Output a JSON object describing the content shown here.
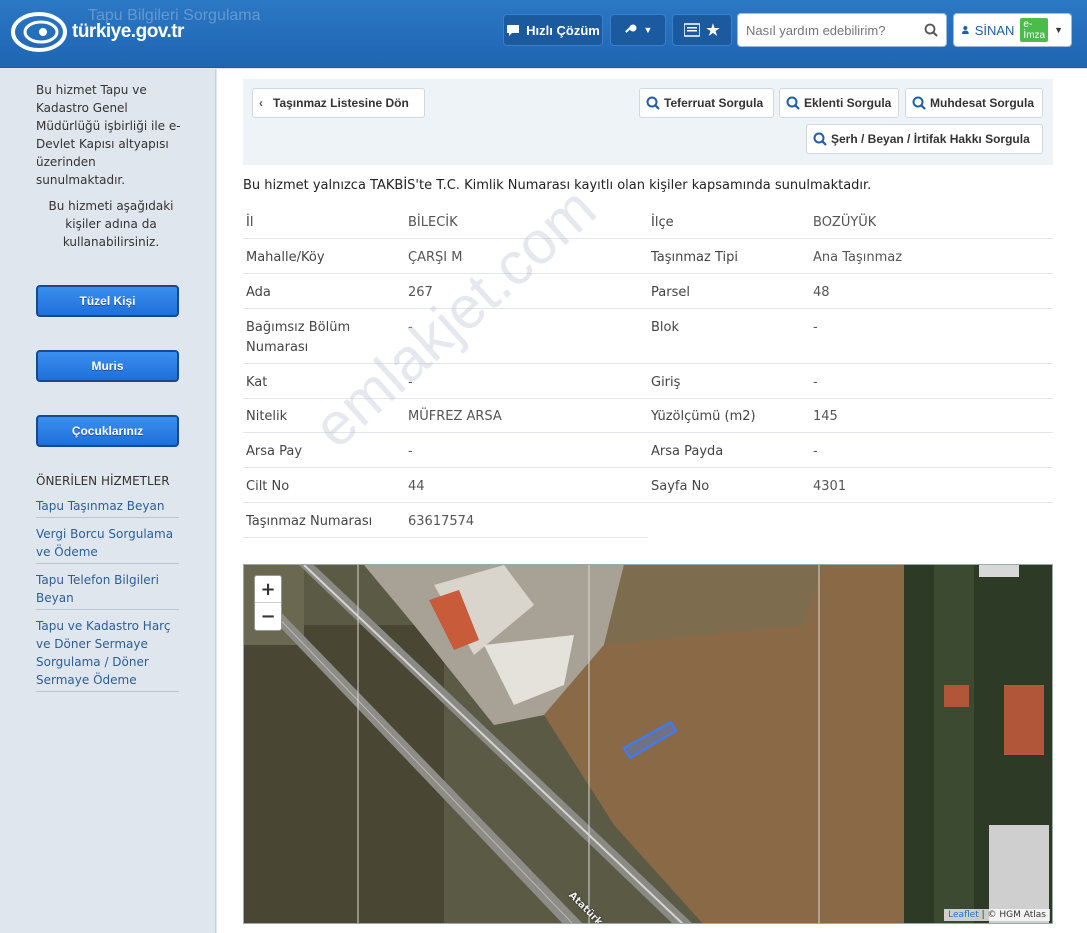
{
  "header": {
    "logo_text": "türkiye.gov.tr",
    "ghost_title": "Tapu Bilgileri Sorgulama",
    "quick_solution_label": "Hızlı Çözüm",
    "search_placeholder": "Nasıl yardım edebilirim?",
    "user_name": "SİNAN",
    "user_badge": "e-İmza",
    "colors": {
      "bar": "#1f65b2",
      "badge": "#4cbb4c"
    }
  },
  "sidebar": {
    "intro": "Bu hizmet Tapu ve Kadastro Genel Müdürlüğü işbirliği ile e-Devlet Kapısı altyapısı üzerinden sunulmaktadır.",
    "others_text": "Bu hizmeti aşağıdaki kişiler adına da kullanabilirsiniz.",
    "buttons": [
      "Tüzel Kişi",
      "Muris",
      "Çocuklarınız"
    ],
    "recommended_heading": "ÖNERİLEN HİZMETLER",
    "links": [
      "Tapu Taşınmaz Beyan",
      "Vergi Borcu Sorgulama ve Ödeme",
      "Tapu Telefon Bilgileri Beyan",
      "Tapu ve Kadastro Harç ve Döner Sermaye Sorgulama / Döner Sermaye Ödeme"
    ]
  },
  "toolbar": {
    "back": "Taşınmaz Listesine Dön",
    "detail": "Teferruat Sorgula",
    "annex": "Eklenti Sorgula",
    "muhdesat": "Muhdesat Sorgula",
    "serh": "Şerh / Beyan / İrtifak Hakkı Sorgula"
  },
  "notice": "Bu hizmet yalnızca TAKBİS'te T.C. Kimlik Numarası kayıtlı olan kişiler kapsamında sunulmaktadır.",
  "fields": {
    "il": {
      "label": "İl",
      "value": "BİLECİK"
    },
    "ilce": {
      "label": "İlçe",
      "value": "BOZÜYÜK"
    },
    "mahalle": {
      "label": "Mahalle/Köy",
      "value": "ÇARŞI M"
    },
    "tip": {
      "label": "Taşınmaz Tipi",
      "value": "Ana Taşınmaz"
    },
    "ada": {
      "label": "Ada",
      "value": "267"
    },
    "parsel": {
      "label": "Parsel",
      "value": "48"
    },
    "bagimsiz": {
      "label": "Bağımsız Bölüm Numarası",
      "value": "-"
    },
    "blok": {
      "label": "Blok",
      "value": "-"
    },
    "kat": {
      "label": "Kat",
      "value": "-"
    },
    "giris": {
      "label": "Giriş",
      "value": "-"
    },
    "nitelik": {
      "label": "Nitelik",
      "value": "MÜFREZ ARSA"
    },
    "yuzolcum": {
      "label": "Yüzölçümü (m2)",
      "value": "145"
    },
    "arsapay": {
      "label": "Arsa Pay",
      "value": "-"
    },
    "arsapayda": {
      "label": "Arsa Payda",
      "value": "-"
    },
    "cilt": {
      "label": "Cilt No",
      "value": "44"
    },
    "sayfa": {
      "label": "Sayfa No",
      "value": "4301"
    },
    "tasinmazno": {
      "label": "Taşınmaz Numarası",
      "value": "63617574"
    }
  },
  "map": {
    "zoom_in": "+",
    "zoom_out": "−",
    "attrib_leaflet": "Leaflet",
    "attrib_rest": "| © HGM Atlas",
    "road_label": "Atatürk C..."
  },
  "watermark": "emlakjet.com"
}
